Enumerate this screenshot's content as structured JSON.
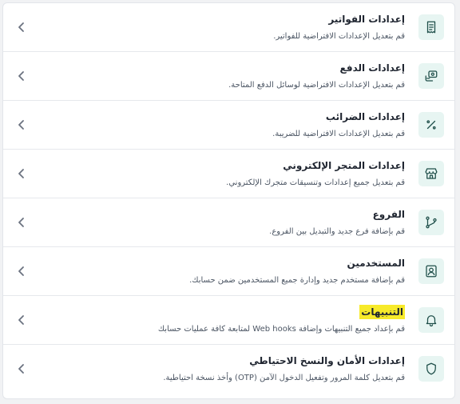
{
  "settings": {
    "items": [
      {
        "title": "إعدادات الفواتير",
        "description": "قم بتعديل الإعدادات الافتراضية للفواتير.",
        "icon": "receipt-icon"
      },
      {
        "title": "إعدادات الدفع",
        "description": "قم بتعديل الإعدادات الافتراضية لوسائل الدفع المتاحة.",
        "icon": "payment-icon"
      },
      {
        "title": "إعدادات الضرائب",
        "description": "قم بتعديل الإعدادات الافتراضية للضريبة.",
        "icon": "percent-icon"
      },
      {
        "title": "إعدادات المتجر الإلكتروني",
        "description": "قم بتعديل جميع إعدادات وتنسيقات متجرك الإلكتروني.",
        "icon": "store-icon"
      },
      {
        "title": "الفروع",
        "description": "قم بإضافة فرع جديد والتبديل بين الفروع.",
        "icon": "branch-icon"
      },
      {
        "title": "المستخدمين",
        "description": "قم بإضافة مستخدم جديد وإدارة جميع المستخدمين ضمن حسابك.",
        "icon": "user-icon"
      },
      {
        "title": "التنبيهات",
        "description": "قم بإعداد جميع التنبيهات وإضافة Web hooks لمتابعة كافة عمليات حسابك",
        "icon": "bell-icon"
      },
      {
        "title": "إعدادات الأمان والنسخ الاحتياطي",
        "description": "قم بتعديل كلمة المرور وتفعيل الدخول الآمن (OTP) وأخذ نسخة احتياطية.",
        "icon": "shield-icon"
      }
    ],
    "highlight_color": "#f7ea2a",
    "icon_bg_color": "#e7f5f2",
    "icon_color": "#1f4f4a"
  }
}
